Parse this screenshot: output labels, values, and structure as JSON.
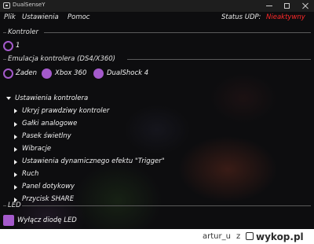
{
  "window": {
    "title": "DualSenseY"
  },
  "menu": {
    "items": [
      "Plik",
      "Ustawienia",
      "Pomoc"
    ],
    "status_label": "Status UDP:",
    "status_value": "Nieaktywny",
    "status_color": "#ff2a2a"
  },
  "controller": {
    "section_label": "Kontroler",
    "selected_index": "1"
  },
  "emulation": {
    "section_label": "Emulacja kontrolera (DS4/X360)",
    "options": [
      {
        "label": "Żaden",
        "selected": false
      },
      {
        "label": "Xbox 360",
        "selected": true
      },
      {
        "label": "DualShock 4",
        "selected": true
      }
    ]
  },
  "settings": {
    "header": "Ustawienia kontrolera",
    "items": [
      "Ukryj prawdziwy kontroler",
      "Gałki analogowe",
      "Pasek świetlny",
      "Wibracje",
      "Ustawienia dynamicznego efektu \"Trigger\"",
      "Ruch",
      "Panel dotykowy",
      "Przycisk SHARE"
    ]
  },
  "led": {
    "section_label": "LED",
    "checkbox_label": "Wyłącz diodę LED",
    "checked": true
  },
  "colors": {
    "accent": "#a45acb",
    "background": "#0d0d0f"
  },
  "watermark": {
    "user": "artur_u",
    "z": "z",
    "site": "wykop.pl"
  }
}
